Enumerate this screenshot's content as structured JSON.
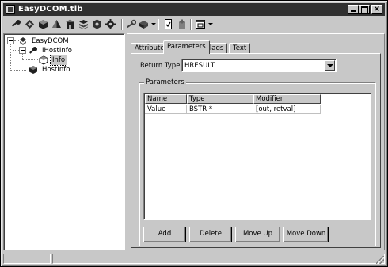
{
  "window": {
    "title": "EasyDCOM.tlb"
  },
  "toolbar": {
    "icons": [
      "key-icon",
      "diamond-icon",
      "cube-icon",
      "pyramid-icon",
      "building-icon",
      "stack-icon",
      "module-icon",
      "gear-icon",
      "wrench-icon",
      "cube-dropdown-icon",
      "file-check-icon",
      "tools-icon",
      "window-dropdown-icon"
    ]
  },
  "tree": {
    "root": "EasyDCOM",
    "interface": "IHostInfo",
    "method": "Info",
    "coclass": "HostInfo"
  },
  "tabs": [
    "Attributes",
    "Parameters",
    "Flags",
    "Text"
  ],
  "active_tab": "Parameters",
  "return_type": {
    "label": "Return Type:",
    "value": "HRESULT"
  },
  "parameters": {
    "group_label": "Parameters",
    "columns": [
      "Name",
      "Type",
      "Modifier"
    ],
    "rows": [
      [
        "Value",
        "BSTR *",
        "[out, retval]"
      ]
    ]
  },
  "buttons": {
    "add": "Add",
    "delete": "Delete",
    "move_up": "Move Up",
    "move_down": "Move Down"
  }
}
